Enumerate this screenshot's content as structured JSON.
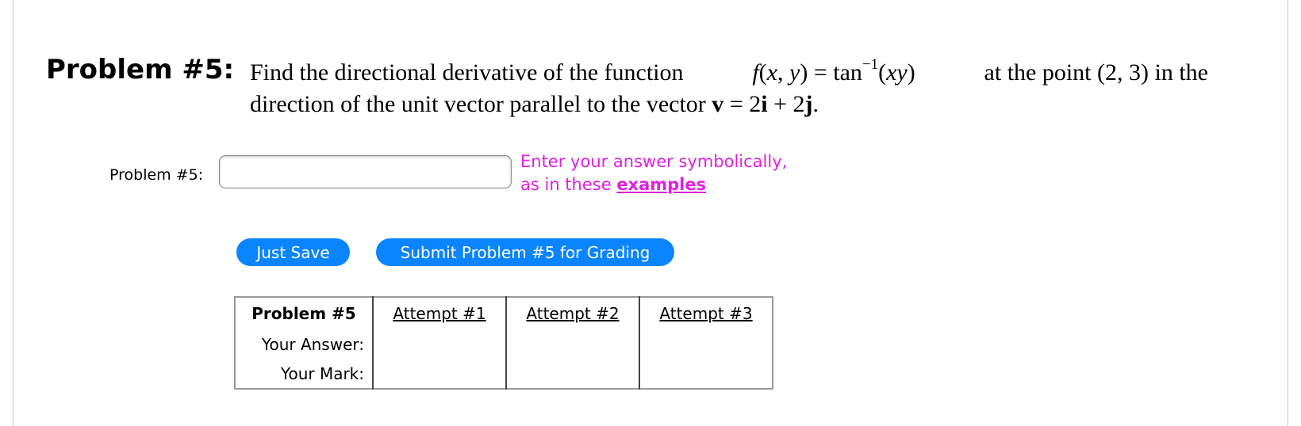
{
  "problem": {
    "heading": "Problem #5:",
    "statement": {
      "t1": "Find the directional derivative of the function",
      "f": "f",
      "args_open": "(",
      "x": "x",
      "comma": ", ",
      "y": "y",
      "args_close": ")",
      "eq": " = tan",
      "sup": "−1",
      "arg2_open": "(",
      "xy": "xy",
      "arg2_close": ")",
      "t2": "at the point (2, 3) in the",
      "t3": "direction of the unit vector parallel to the vector ",
      "v": "v",
      "t4": " = 2",
      "i": "i",
      "t5": " + 2",
      "j": "j",
      "t6": "."
    }
  },
  "answer": {
    "label": "Problem #5:",
    "value": "",
    "placeholder": ""
  },
  "hint": {
    "line1": "Enter your answer symbolically,",
    "line2_prefix": "as in these ",
    "link": "examples"
  },
  "buttons": {
    "save": "Just Save",
    "submit": "Submit Problem #5 for Grading"
  },
  "attempts_table": {
    "header": "Problem #5",
    "attempts": [
      "Attempt #1",
      "Attempt #2",
      "Attempt #3"
    ],
    "row_labels": [
      "Your Answer:",
      "Your Mark:"
    ]
  }
}
